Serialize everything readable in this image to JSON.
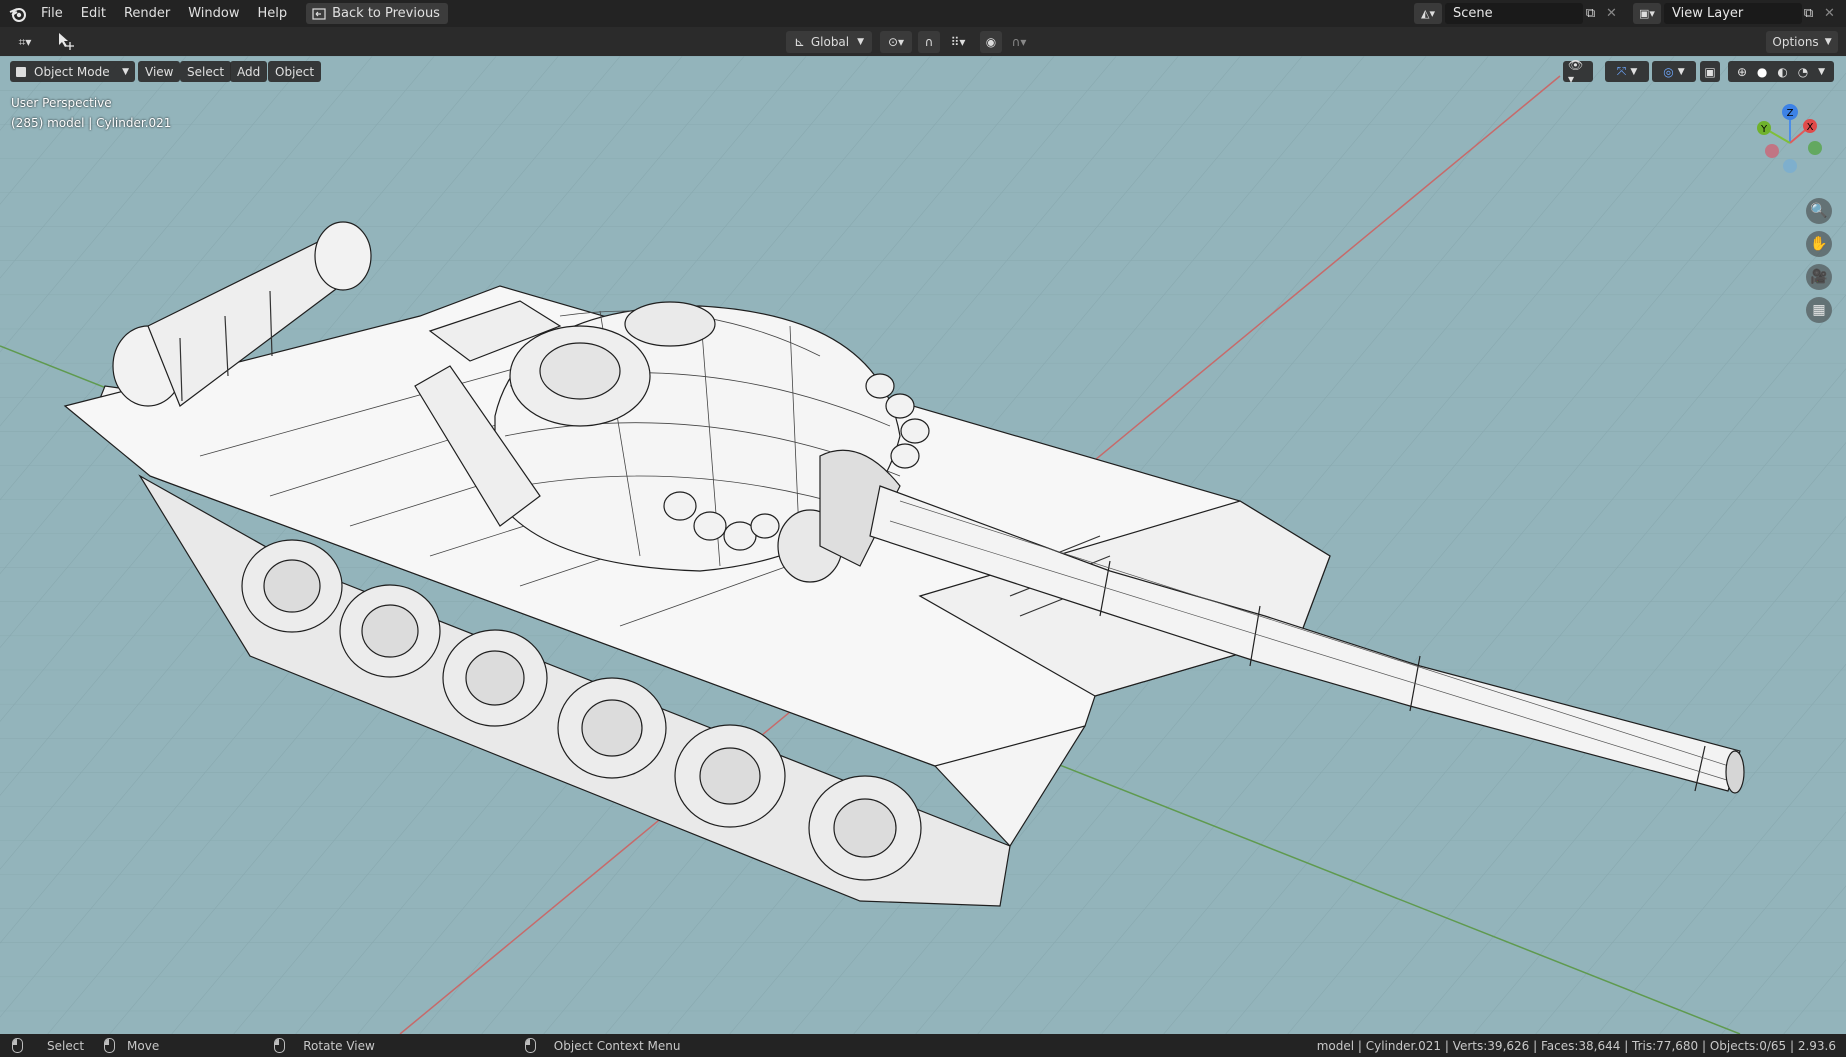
{
  "menu": {
    "file": "File",
    "edit": "Edit",
    "render": "Render",
    "window": "Window",
    "help": "Help",
    "back_to_previous": "Back to Previous"
  },
  "scene": {
    "name": "Scene"
  },
  "view_layer": {
    "name": "View Layer"
  },
  "header": {
    "orientation": "Global",
    "options": "Options"
  },
  "viewport": {
    "mode": "Object Mode",
    "view": "View",
    "select": "Select",
    "add": "Add",
    "object": "Object",
    "perspective": "User Perspective",
    "active_object": "(285) model | Cylinder.021",
    "gizmo": {
      "z": "Z",
      "x": "X",
      "y": "Y"
    },
    "background_color": "#93b4bb"
  },
  "statusbar": {
    "select": "Select",
    "move": "Move",
    "rotate_view": "Rotate View",
    "context_menu": "Object Context Menu",
    "stats": "model | Cylinder.021 | Verts:39,626 | Faces:38,644 | Tris:77,680 | Objects:0/65 | 2.93.6"
  }
}
